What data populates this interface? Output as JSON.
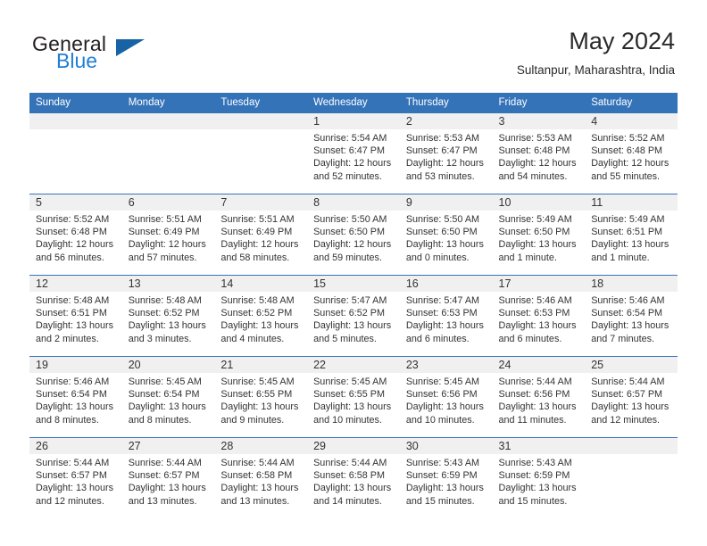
{
  "brand": {
    "word_one": "General",
    "word_two": "Blue"
  },
  "header": {
    "title": "May 2024",
    "location": "Sultanpur, Maharashtra, India"
  },
  "colors": {
    "header_blue": "#3573b9",
    "brand_blue": "#1f7fd4",
    "daynum_band": "#f0f0f0"
  },
  "weekday_headers": [
    "Sunday",
    "Monday",
    "Tuesday",
    "Wednesday",
    "Thursday",
    "Friday",
    "Saturday"
  ],
  "weeks": [
    [
      {
        "day": "",
        "sunrise": "",
        "sunset": "",
        "daylight_line1": "",
        "daylight_line2": ""
      },
      {
        "day": "",
        "sunrise": "",
        "sunset": "",
        "daylight_line1": "",
        "daylight_line2": ""
      },
      {
        "day": "",
        "sunrise": "",
        "sunset": "",
        "daylight_line1": "",
        "daylight_line2": ""
      },
      {
        "day": "1",
        "sunrise": "Sunrise: 5:54 AM",
        "sunset": "Sunset: 6:47 PM",
        "daylight_line1": "Daylight: 12 hours",
        "daylight_line2": "and 52 minutes."
      },
      {
        "day": "2",
        "sunrise": "Sunrise: 5:53 AM",
        "sunset": "Sunset: 6:47 PM",
        "daylight_line1": "Daylight: 12 hours",
        "daylight_line2": "and 53 minutes."
      },
      {
        "day": "3",
        "sunrise": "Sunrise: 5:53 AM",
        "sunset": "Sunset: 6:48 PM",
        "daylight_line1": "Daylight: 12 hours",
        "daylight_line2": "and 54 minutes."
      },
      {
        "day": "4",
        "sunrise": "Sunrise: 5:52 AM",
        "sunset": "Sunset: 6:48 PM",
        "daylight_line1": "Daylight: 12 hours",
        "daylight_line2": "and 55 minutes."
      }
    ],
    [
      {
        "day": "5",
        "sunrise": "Sunrise: 5:52 AM",
        "sunset": "Sunset: 6:48 PM",
        "daylight_line1": "Daylight: 12 hours",
        "daylight_line2": "and 56 minutes."
      },
      {
        "day": "6",
        "sunrise": "Sunrise: 5:51 AM",
        "sunset": "Sunset: 6:49 PM",
        "daylight_line1": "Daylight: 12 hours",
        "daylight_line2": "and 57 minutes."
      },
      {
        "day": "7",
        "sunrise": "Sunrise: 5:51 AM",
        "sunset": "Sunset: 6:49 PM",
        "daylight_line1": "Daylight: 12 hours",
        "daylight_line2": "and 58 minutes."
      },
      {
        "day": "8",
        "sunrise": "Sunrise: 5:50 AM",
        "sunset": "Sunset: 6:50 PM",
        "daylight_line1": "Daylight: 12 hours",
        "daylight_line2": "and 59 minutes."
      },
      {
        "day": "9",
        "sunrise": "Sunrise: 5:50 AM",
        "sunset": "Sunset: 6:50 PM",
        "daylight_line1": "Daylight: 13 hours",
        "daylight_line2": "and 0 minutes."
      },
      {
        "day": "10",
        "sunrise": "Sunrise: 5:49 AM",
        "sunset": "Sunset: 6:50 PM",
        "daylight_line1": "Daylight: 13 hours",
        "daylight_line2": "and 1 minute."
      },
      {
        "day": "11",
        "sunrise": "Sunrise: 5:49 AM",
        "sunset": "Sunset: 6:51 PM",
        "daylight_line1": "Daylight: 13 hours",
        "daylight_line2": "and 1 minute."
      }
    ],
    [
      {
        "day": "12",
        "sunrise": "Sunrise: 5:48 AM",
        "sunset": "Sunset: 6:51 PM",
        "daylight_line1": "Daylight: 13 hours",
        "daylight_line2": "and 2 minutes."
      },
      {
        "day": "13",
        "sunrise": "Sunrise: 5:48 AM",
        "sunset": "Sunset: 6:52 PM",
        "daylight_line1": "Daylight: 13 hours",
        "daylight_line2": "and 3 minutes."
      },
      {
        "day": "14",
        "sunrise": "Sunrise: 5:48 AM",
        "sunset": "Sunset: 6:52 PM",
        "daylight_line1": "Daylight: 13 hours",
        "daylight_line2": "and 4 minutes."
      },
      {
        "day": "15",
        "sunrise": "Sunrise: 5:47 AM",
        "sunset": "Sunset: 6:52 PM",
        "daylight_line1": "Daylight: 13 hours",
        "daylight_line2": "and 5 minutes."
      },
      {
        "day": "16",
        "sunrise": "Sunrise: 5:47 AM",
        "sunset": "Sunset: 6:53 PM",
        "daylight_line1": "Daylight: 13 hours",
        "daylight_line2": "and 6 minutes."
      },
      {
        "day": "17",
        "sunrise": "Sunrise: 5:46 AM",
        "sunset": "Sunset: 6:53 PM",
        "daylight_line1": "Daylight: 13 hours",
        "daylight_line2": "and 6 minutes."
      },
      {
        "day": "18",
        "sunrise": "Sunrise: 5:46 AM",
        "sunset": "Sunset: 6:54 PM",
        "daylight_line1": "Daylight: 13 hours",
        "daylight_line2": "and 7 minutes."
      }
    ],
    [
      {
        "day": "19",
        "sunrise": "Sunrise: 5:46 AM",
        "sunset": "Sunset: 6:54 PM",
        "daylight_line1": "Daylight: 13 hours",
        "daylight_line2": "and 8 minutes."
      },
      {
        "day": "20",
        "sunrise": "Sunrise: 5:45 AM",
        "sunset": "Sunset: 6:54 PM",
        "daylight_line1": "Daylight: 13 hours",
        "daylight_line2": "and 8 minutes."
      },
      {
        "day": "21",
        "sunrise": "Sunrise: 5:45 AM",
        "sunset": "Sunset: 6:55 PM",
        "daylight_line1": "Daylight: 13 hours",
        "daylight_line2": "and 9 minutes."
      },
      {
        "day": "22",
        "sunrise": "Sunrise: 5:45 AM",
        "sunset": "Sunset: 6:55 PM",
        "daylight_line1": "Daylight: 13 hours",
        "daylight_line2": "and 10 minutes."
      },
      {
        "day": "23",
        "sunrise": "Sunrise: 5:45 AM",
        "sunset": "Sunset: 6:56 PM",
        "daylight_line1": "Daylight: 13 hours",
        "daylight_line2": "and 10 minutes."
      },
      {
        "day": "24",
        "sunrise": "Sunrise: 5:44 AM",
        "sunset": "Sunset: 6:56 PM",
        "daylight_line1": "Daylight: 13 hours",
        "daylight_line2": "and 11 minutes."
      },
      {
        "day": "25",
        "sunrise": "Sunrise: 5:44 AM",
        "sunset": "Sunset: 6:57 PM",
        "daylight_line1": "Daylight: 13 hours",
        "daylight_line2": "and 12 minutes."
      }
    ],
    [
      {
        "day": "26",
        "sunrise": "Sunrise: 5:44 AM",
        "sunset": "Sunset: 6:57 PM",
        "daylight_line1": "Daylight: 13 hours",
        "daylight_line2": "and 12 minutes."
      },
      {
        "day": "27",
        "sunrise": "Sunrise: 5:44 AM",
        "sunset": "Sunset: 6:57 PM",
        "daylight_line1": "Daylight: 13 hours",
        "daylight_line2": "and 13 minutes."
      },
      {
        "day": "28",
        "sunrise": "Sunrise: 5:44 AM",
        "sunset": "Sunset: 6:58 PM",
        "daylight_line1": "Daylight: 13 hours",
        "daylight_line2": "and 13 minutes."
      },
      {
        "day": "29",
        "sunrise": "Sunrise: 5:44 AM",
        "sunset": "Sunset: 6:58 PM",
        "daylight_line1": "Daylight: 13 hours",
        "daylight_line2": "and 14 minutes."
      },
      {
        "day": "30",
        "sunrise": "Sunrise: 5:43 AM",
        "sunset": "Sunset: 6:59 PM",
        "daylight_line1": "Daylight: 13 hours",
        "daylight_line2": "and 15 minutes."
      },
      {
        "day": "31",
        "sunrise": "Sunrise: 5:43 AM",
        "sunset": "Sunset: 6:59 PM",
        "daylight_line1": "Daylight: 13 hours",
        "daylight_line2": "and 15 minutes."
      },
      {
        "day": "",
        "sunrise": "",
        "sunset": "",
        "daylight_line1": "",
        "daylight_line2": ""
      }
    ]
  ]
}
